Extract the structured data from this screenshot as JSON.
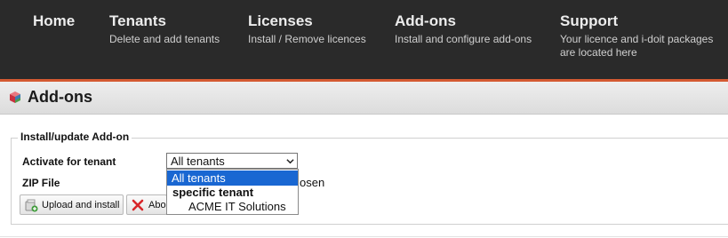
{
  "nav": {
    "home": {
      "title": "Home"
    },
    "tenants": {
      "title": "Tenants",
      "desc": "Delete and add tenants"
    },
    "licenses": {
      "title": "Licenses",
      "desc": "Install / Remove licences"
    },
    "addons": {
      "title": "Add-ons",
      "desc": "Install and configure add-ons"
    },
    "support": {
      "title": "Support",
      "desc_line1": "Your licence and i-doit packages",
      "desc_line2": "are located here"
    }
  },
  "page": {
    "title": "Add-ons",
    "icon": "addons-cube-icon"
  },
  "form": {
    "legend": "Install/update Add-on",
    "tenant_label": "Activate for tenant",
    "tenant_selected": "All tenants",
    "tenant_options": {
      "all": "All tenants",
      "group": "specific tenant",
      "child": "ACME IT Solutions"
    },
    "zip_label": "ZIP File",
    "file_status_fragment": "osen",
    "upload_button": "Upload and install",
    "abort_button_fragment": "Abo"
  },
  "colors": {
    "nav_bg": "#2a2a2a",
    "nav_accent": "#d45a32",
    "selected_option": "#1967d2"
  }
}
